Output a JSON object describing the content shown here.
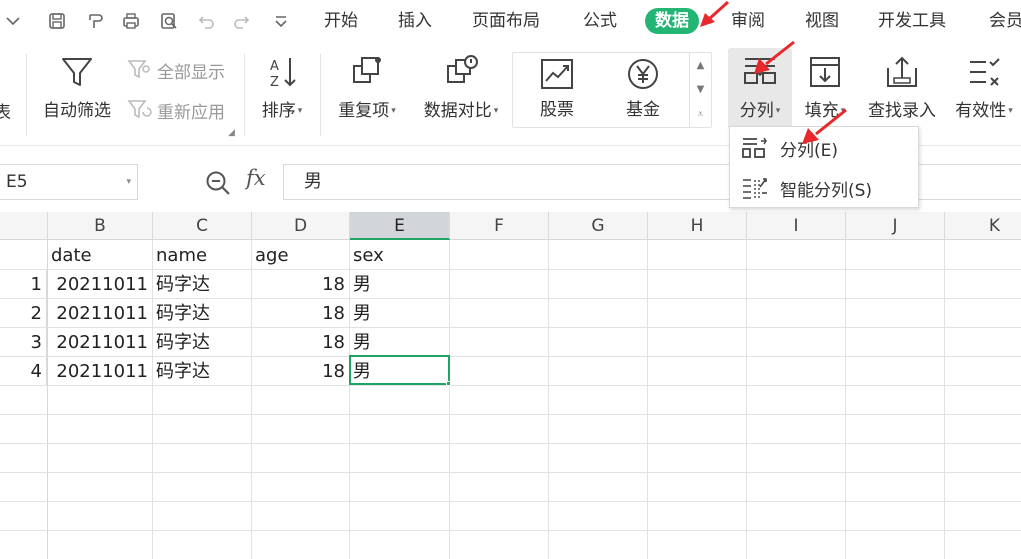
{
  "menubar": {
    "tabs": [
      "开始",
      "插入",
      "页面布局",
      "公式",
      "数据",
      "审阅",
      "视图",
      "开发工具",
      "会员"
    ],
    "active_tab": "数据",
    "accent_color": "#22b573"
  },
  "ribbon": {
    "autofilter": "自动筛选",
    "show_all": "全部显示",
    "reapply": "重新应用",
    "sort": "排序",
    "duplicates": "重复项",
    "compare": "数据对比",
    "stocks": "股票",
    "funds": "基金",
    "split": "分列",
    "fill": "填充",
    "lookup_entry": "查找录入",
    "validity": "有效性",
    "left_partial": "表"
  },
  "dropdown": {
    "items": [
      "分列(E)",
      "智能分列(S)"
    ]
  },
  "formula_bar": {
    "name_box": "E5",
    "fx": "fx",
    "value": "男"
  },
  "grid": {
    "columns": [
      "B",
      "C",
      "D",
      "E",
      "F",
      "G",
      "H",
      "I",
      "J",
      "K"
    ],
    "selected_column": "E",
    "selected_cell": "E5",
    "header_row": [
      "date",
      "name",
      "age",
      "sex"
    ],
    "rows": [
      {
        "index": "1",
        "date": "20211011",
        "name": "码字达",
        "age": "18",
        "sex": "男"
      },
      {
        "index": "2",
        "date": "20211011",
        "name": "码字达",
        "age": "18",
        "sex": "男"
      },
      {
        "index": "3",
        "date": "20211011",
        "name": "码字达",
        "age": "18",
        "sex": "男"
      },
      {
        "index": "4",
        "date": "20211011",
        "name": "码字达",
        "age": "18",
        "sex": "男"
      }
    ]
  },
  "annotation_color": "#e8282b"
}
